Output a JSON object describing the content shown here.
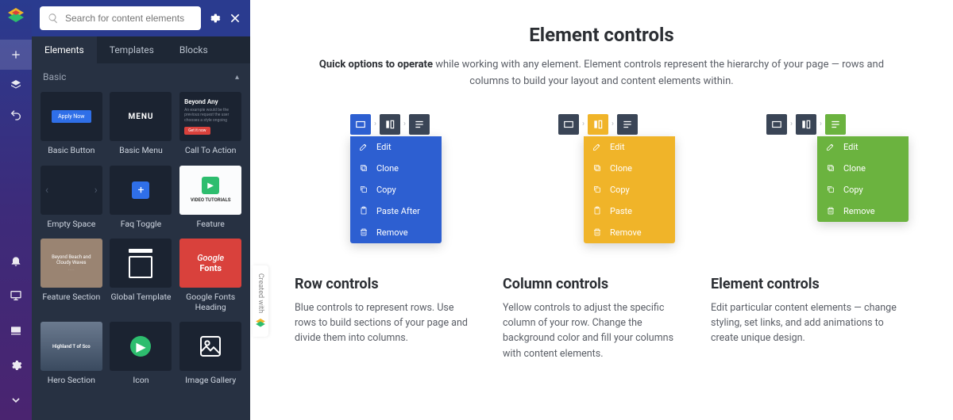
{
  "rail": {
    "items": [
      "add",
      "layers",
      "undo"
    ],
    "bottom": [
      "bell",
      "desktop",
      "present",
      "gear",
      "chevron"
    ]
  },
  "search": {
    "placeholder": "Search for content elements"
  },
  "tabs": [
    {
      "label": "Elements",
      "active": true
    },
    {
      "label": "Templates",
      "active": false
    },
    {
      "label": "Blocks",
      "active": false
    }
  ],
  "category": "Basic",
  "cards": [
    {
      "label": "Basic Button",
      "kind": "btn",
      "text": "Apply Now"
    },
    {
      "label": "Basic Menu",
      "kind": "menu",
      "text": "MENU"
    },
    {
      "label": "Call To Action",
      "kind": "cta",
      "head": "Beyond Any",
      "body": "An example would be the previous request the user chooses a style ongoing",
      "btn": "Get it now"
    },
    {
      "label": "Empty Space",
      "kind": "empty"
    },
    {
      "label": "Faq Toggle",
      "kind": "faq"
    },
    {
      "label": "Feature",
      "kind": "feat",
      "text": "VIDEO TUTORIALS"
    },
    {
      "label": "Feature Section",
      "kind": "fs",
      "text": "Beyond Beach and Cloudy Waves"
    },
    {
      "label": "Global Template",
      "kind": "gt"
    },
    {
      "label": "Google Fonts Heading",
      "kind": "gf",
      "g": "Google",
      "f": "Fonts"
    },
    {
      "label": "Hero Section",
      "kind": "hero",
      "text": "Highland T of Sco"
    },
    {
      "label": "Icon",
      "kind": "icon"
    },
    {
      "label": "Image Gallery",
      "kind": "img"
    }
  ],
  "page": {
    "title": "Element controls",
    "sub_bold": "Quick options to operate",
    "sub_rest": " while working with any element. Element controls represent the hierarchy of your page — rows and columns to build your layout and content elements within."
  },
  "columns": [
    {
      "color": "blue",
      "menu": [
        "Edit",
        "Clone",
        "Copy",
        "Paste After",
        "Remove"
      ],
      "heading": "Row controls",
      "desc": "Blue controls to represent rows. Use rows to build sections of your page and divide them into columns."
    },
    {
      "color": "yellow",
      "menu": [
        "Edit",
        "Clone",
        "Copy",
        "Paste",
        "Remove"
      ],
      "heading": "Column controls",
      "desc": "Yellow controls to adjust the specific column of your row. Change the background color and fill your columns with content elements."
    },
    {
      "color": "green",
      "menu": [
        "Edit",
        "Clone",
        "Copy",
        "Remove"
      ],
      "heading": "Element controls",
      "desc": "Edit particular content elements — change styling, set links, and add animations to create unique design."
    }
  ],
  "created_with": "Created with"
}
